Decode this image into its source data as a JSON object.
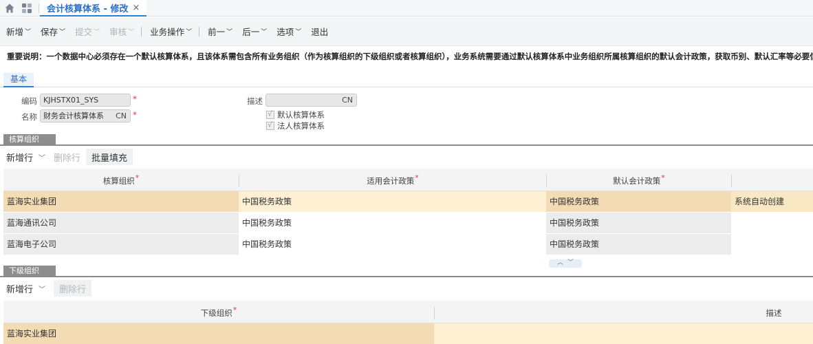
{
  "tab_bar": {
    "active_tab_title": "会计核算体系 - 修改",
    "close_glyph": "×",
    "icons": [
      "home-icon",
      "apps-icon",
      "close-icon"
    ]
  },
  "toolbar": {
    "buttons": [
      {
        "label": "新增",
        "caret": "﹀",
        "disabled": false
      },
      {
        "label": "保存",
        "caret": "﹀",
        "disabled": false
      },
      {
        "label": "提交",
        "caret": "﹀",
        "disabled": true
      },
      {
        "label": "审核",
        "caret": "﹀",
        "disabled": true
      },
      {
        "label": "业务操作",
        "caret": "﹀",
        "disabled": false
      },
      {
        "label": "前一",
        "caret": "﹀",
        "disabled": false
      },
      {
        "label": "后一",
        "caret": "﹀",
        "disabled": false
      },
      {
        "label": "选项",
        "caret": "﹀",
        "disabled": false
      },
      {
        "label": "退出",
        "caret": "",
        "disabled": false
      }
    ]
  },
  "notice": "重要说明：一个数据中心必须存在一个默认核算体系，且该体系需包含所有业务组织（作为核算组织的下级组织或者核算组织），业务系统需要通过默认核算体系中业务组织所属核算组织的默认会计政策，获取币别、默认汇率等必要信息。",
  "main_tabs": [
    "基本"
  ],
  "form": {
    "code_label": "编码",
    "code_value": "KJHSTX01_SYS",
    "name_label": "名称",
    "name_value": "财务会计核算体系",
    "name_lang": "CN",
    "desc_label": "描述",
    "desc_value": "",
    "desc_lang": "CN",
    "required_mark": "*",
    "default_system_label": "默认核算体系",
    "default_system_checked": true,
    "legal_entity_system_label": "法人核算体系",
    "legal_entity_system_checked": true,
    "check_glyph": "√"
  },
  "section_accounting_org": {
    "tag": "核算组织",
    "tools": {
      "add_row": "新增行",
      "add_row_caret": "﹀",
      "delete_row": "删除行",
      "batch_fill": "批量填充"
    },
    "columns": [
      "核算组织",
      "适用会计政策",
      "默认会计政策",
      ""
    ],
    "required_mark": "*",
    "rows": [
      {
        "org": "蓝海实业集团",
        "applicable_policy": "中国税务政策",
        "default_policy": "中国税务政策",
        "note": "系统自动创建",
        "selected": true
      },
      {
        "org": "蓝海通讯公司",
        "applicable_policy": "中国税务政策",
        "default_policy": "中国税务政策",
        "note": "",
        "selected": false
      },
      {
        "org": "蓝海电子公司",
        "applicable_policy": "中国税务政策",
        "default_policy": "中国税务政策",
        "note": "",
        "selected": false
      }
    ],
    "scroll_arrows": "︿﹀"
  },
  "section_sub_org": {
    "tag": "下级组织",
    "tools": {
      "add_row": "新增行",
      "add_row_caret": "﹀",
      "delete_row": "删除行"
    },
    "columns": [
      "下级组织",
      "描述"
    ],
    "required_mark": "*",
    "rows": [
      {
        "org": "蓝海实业集团",
        "desc": "",
        "selected": true
      }
    ]
  },
  "colors": {
    "accent": "#2e7fd8",
    "selected_row": "#fae7c4",
    "selected_row_edit": "#fdf0d3",
    "readonly_cell": "#ececec",
    "section_tag": "#8d8d8d",
    "required": "#e23c3c"
  }
}
